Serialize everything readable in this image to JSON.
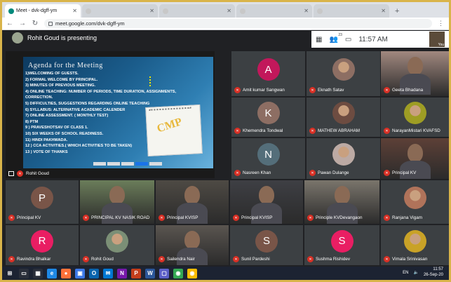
{
  "browser": {
    "tabs": [
      {
        "title": "Meet - dvk-dgff-ym",
        "active": true,
        "favicon_color": "#00897b"
      },
      {
        "title": "",
        "active": false,
        "favicon_color": "#c8c8c8"
      },
      {
        "title": "",
        "active": false,
        "favicon_color": "#c8c8c8"
      },
      {
        "title": "",
        "active": false,
        "favicon_color": "#c8c8c8"
      },
      {
        "title": "",
        "active": false,
        "favicon_color": "#c8c8c8"
      }
    ],
    "url": "meet.google.com/dvk-dgff-ym"
  },
  "meet": {
    "presenting_text": "Rohit Goud is presenting",
    "clock": "11:57 AM",
    "participant_count_badge": "23",
    "self_label": "You",
    "presentation_caption": "Rohit Goud"
  },
  "slide": {
    "title": "Agenda for the Meeting",
    "items": [
      "1)WELCOMING OF GUESTS.",
      "2) FORMAL WELCOME BY PRINCIPAL.",
      "3) MINUTES OF PREVIOUS MEETING.",
      "4) ONLINE TEACHING: NUMBER OF PERIODS, TIME DURATION, ASSIGNMENTS,",
      "CORRECTION.",
      "5) DIFFICULTIES, SUGGESTIONS REGARDING ONLINE TEACHING",
      "6) SYLLABUS: ALTERNATIVE   ACADEMIC CALENDER",
      "7) ONLINE ASSESSMENT. ( MONTHLY TEST)",
      "8) PTM",
      "9 ) PRAVESHOTSAV OF CLASS 1.",
      "10) SIX WEEKS OF SCHOOL READINESS.",
      "11) HINDI PAKHWADA.",
      "12 ) CCA ACTIVITIES.( WHICH ACTIVITIES TO BE TAKEN)",
      "13 ) VOTE OF THANKS"
    ],
    "image_text": "CMP"
  },
  "participants": [
    {
      "name": "Amit kumar Sangwan",
      "initial": "A",
      "color": "#c2185b"
    },
    {
      "name": "Eknath Satav",
      "initial": "",
      "color": "#8d6e63"
    },
    {
      "name": "Geeta Bhadana",
      "initial": "",
      "color": "#a1887f"
    },
    {
      "name": "Khemendra Tondwal",
      "initial": "K",
      "color": "#8d6e63"
    },
    {
      "name": "MATHEW ABRAHAM",
      "initial": "",
      "color": "#6d4c41"
    },
    {
      "name": "NarayanMistari KVAFSD",
      "initial": "",
      "color": "#9e9d24"
    },
    {
      "name": "Nasreen Khan",
      "initial": "N",
      "color": "#546e7a"
    },
    {
      "name": "Pawan Dulange",
      "initial": "",
      "color": "#bcaaa4"
    },
    {
      "name": "Principal KV",
      "initial": "",
      "color": "#5d4037"
    },
    {
      "name": "Principal KV",
      "initial": "P",
      "color": "#795548"
    },
    {
      "name": "PRINCIPAL KV NASIK ROAD",
      "initial": "",
      "color": "#6b7d5a"
    },
    {
      "name": "Principal KVISP",
      "initial": "",
      "color": "#4e4a44"
    },
    {
      "name": "Principal KVISP",
      "initial": "",
      "color": "#3e3f44"
    },
    {
      "name": "Principle KVDevangaon",
      "initial": "",
      "color": "#7a756c"
    },
    {
      "name": "Ranjana Vigam",
      "initial": "",
      "color": "#b0735a"
    },
    {
      "name": "Ravindra Bhalkar",
      "initial": "R",
      "color": "#e91e63"
    },
    {
      "name": "Rohit Goud",
      "initial": "",
      "color": "#7b8f76"
    },
    {
      "name": "Sailendra Nair",
      "initial": "",
      "color": "#5a5550"
    },
    {
      "name": "Sunil Pardeshi",
      "initial": "S",
      "color": "#795548"
    },
    {
      "name": "Sushma Rishidev",
      "initial": "S",
      "color": "#e91e63"
    },
    {
      "name": "Vimala Srinivasan",
      "initial": "",
      "color": "#c9a227"
    }
  ],
  "taskbar": {
    "apps": [
      {
        "icon": "windows-start-icon",
        "glyph": "⊞",
        "color": "#1c2332"
      },
      {
        "icon": "file-explorer-icon",
        "glyph": "▭",
        "color": "#2a2f3a"
      },
      {
        "icon": "task-view-icon",
        "glyph": "▦",
        "color": "#2a2f3a"
      },
      {
        "icon": "edge-icon",
        "glyph": "e",
        "color": "#1e88e5"
      },
      {
        "icon": "firefox-icon",
        "glyph": "●",
        "color": "#ff7139"
      },
      {
        "icon": "photos-icon",
        "glyph": "▣",
        "color": "#3b78e7"
      },
      {
        "icon": "outlook-icon",
        "glyph": "O",
        "color": "#0a64ad"
      },
      {
        "icon": "mail-icon",
        "glyph": "✉",
        "color": "#0078d4"
      },
      {
        "icon": "onenote-icon",
        "glyph": "N",
        "color": "#7719aa"
      },
      {
        "icon": "powerpoint-icon",
        "glyph": "P",
        "color": "#c43e1c"
      },
      {
        "icon": "word-icon",
        "glyph": "W",
        "color": "#2b579a"
      },
      {
        "icon": "teams-icon",
        "glyph": "▢",
        "color": "#5b5fc7"
      },
      {
        "icon": "chrome-icon",
        "glyph": "◉",
        "color": "#34a853"
      },
      {
        "icon": "chrome-active-icon",
        "glyph": "◉",
        "color": "#fbbc04"
      }
    ],
    "lang": "EN",
    "time": "11:57",
    "date": "26-Sep-20"
  }
}
